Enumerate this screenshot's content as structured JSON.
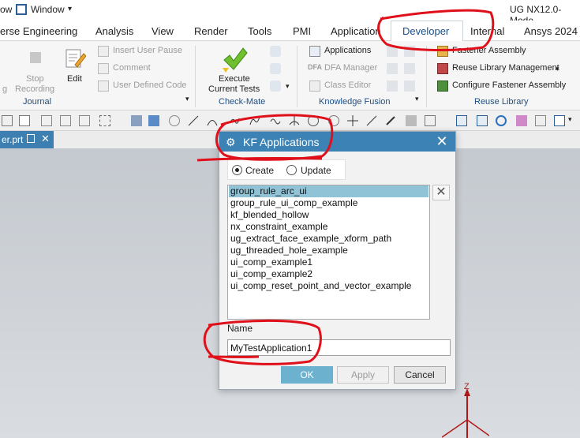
{
  "title_bar": {
    "left_text": "ow",
    "window_menu": "Window",
    "window_caret": "▾",
    "app_title": "UG NX12.0-Mode"
  },
  "tabs": [
    {
      "label": "erse Engineering"
    },
    {
      "label": "Analysis"
    },
    {
      "label": "View"
    },
    {
      "label": "Render"
    },
    {
      "label": "Tools"
    },
    {
      "label": "PMI"
    },
    {
      "label": "Application"
    },
    {
      "label": "Developer",
      "active": true
    },
    {
      "label": "Internal"
    },
    {
      "label": "Ansys 2024"
    }
  ],
  "ribbon": {
    "journal": {
      "stop_recording_1": "Stop",
      "stop_recording_2": "Recording",
      "left_clip": "g",
      "edit": "Edit",
      "insert_user_pause": "Insert User Pause",
      "comment": "Comment",
      "user_defined_code": "User Defined Code",
      "label": "Journal"
    },
    "checkmate": {
      "execute_1": "Execute",
      "execute_2": "Current Tests",
      "label": "Check-Mate"
    },
    "knowledge_fusion": {
      "applications": "Applications",
      "dfa_manager": "DFA Manager",
      "class_editor": "Class Editor",
      "label": "Knowledge Fusion"
    },
    "reuse_library": {
      "fastener_assembly": "Fastener Assembly",
      "reuse_library_management": "Reuse Library Management",
      "configure_fastener_assembly": "Configure Fastener Assembly",
      "label": "Reuse Library"
    }
  },
  "doc_tab": {
    "label": "er.prt"
  },
  "dialog": {
    "title": "KF Applications",
    "close": "✕",
    "mode": {
      "create": "Create",
      "update": "Update",
      "selected": "Create"
    },
    "list_items": [
      "group_rule_arc_ui",
      "group_rule_ui_comp_example",
      "kf_blended_hollow",
      "nx_constraint_example",
      "ug_extract_face_example_xform_path",
      "ug_threaded_hole_example",
      "ui_comp_example1",
      "ui_comp_example2",
      "ui_comp_reset_point_and_vector_example"
    ],
    "selected_index": 0,
    "clear_button": "✕",
    "name_label": "Name",
    "name_value": "MyTestApplication1",
    "ok": "OK",
    "apply": "Apply",
    "cancel": "Cancel"
  },
  "axis_label": "Z",
  "colors": {
    "dialog_title_bar": "#3c82b4",
    "ok_button": "#6cb2cf",
    "selection": "#90c3d6",
    "annotation_red": "#e0101a",
    "group_label": "#1d4f86"
  }
}
